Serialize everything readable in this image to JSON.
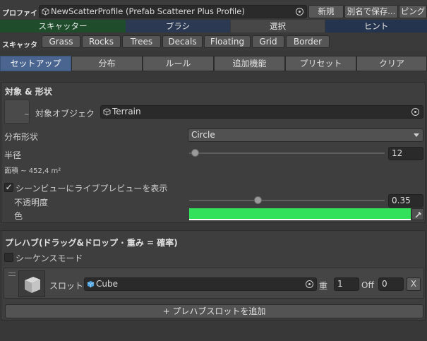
{
  "profile": {
    "label": "プロファイ",
    "name": "NewScatterProfile (Prefab Scatterer Plus Profile)",
    "new_label": "新規",
    "save_as_label": "別名で保存...",
    "ping_label": "ピング"
  },
  "main_tabs": [
    {
      "label": "スキャッター",
      "color": "#1f4d2b"
    },
    {
      "label": "ブラシ",
      "color": "#2b3a52"
    },
    {
      "label": "選択",
      "color": "#474747"
    },
    {
      "label": "ヒント",
      "color": "#25344e"
    }
  ],
  "scatter_bar": {
    "label": "スキャッタ",
    "buttons": [
      "Grass",
      "Rocks",
      "Trees",
      "Decals",
      "Floating",
      "Grid",
      "Border"
    ]
  },
  "sub_tabs": [
    "セットアップ",
    "分布",
    "ルール",
    "追加機能",
    "プリセット",
    "クリア"
  ],
  "target_section": {
    "title": "対象 & 形状",
    "target_object_label": "対象オブジェク",
    "target_object_value": "Terrain",
    "distribution_shape_label": "分布形状",
    "distribution_shape_value": "Circle",
    "radius_label": "半径",
    "radius_value": "12",
    "radius_fraction": 0.03,
    "area_label": "面積 ~ 452,4 m²",
    "live_preview_label": "シーンビューにライブプレビューを表示",
    "live_preview_checked": true,
    "opacity_label": "不透明度",
    "opacity_value": "0.35",
    "opacity_fraction": 0.35,
    "color_label": "色",
    "color_value": "#33e25a"
  },
  "prefab_section": {
    "title": "プレハブ(ドラッグ&ドロップ · 重み = 確率)",
    "sequence_mode_label": "シーケンスモード",
    "sequence_mode_checked": false,
    "slot": {
      "slot_label": "スロット",
      "prefab_name": "Cube",
      "weight_label": "重",
      "weight_value": "1",
      "offset_label": "Off",
      "offset_value": "0",
      "remove_label": "X"
    },
    "add_slot_label": "+ プレハブスロットを追加"
  }
}
